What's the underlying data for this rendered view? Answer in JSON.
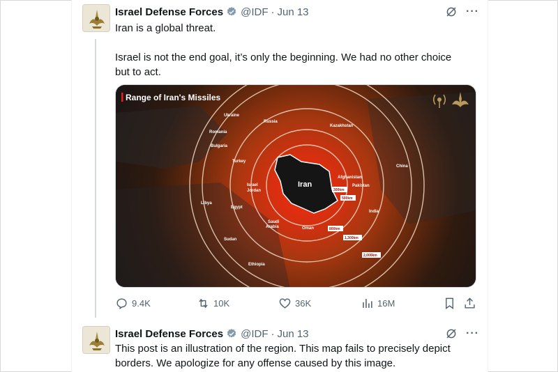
{
  "colors": {
    "text": "#0f1419",
    "muted": "#536471",
    "verified": "#829aab"
  },
  "posts": [
    {
      "name": "Israel Defense Forces",
      "handle": "@IDF",
      "separator": "·",
      "date": "Jun 13",
      "text_lines": [
        "Iran is a global threat.",
        "Israel is not the end goal, it’s only the beginning. We had no other choice",
        "but to act."
      ],
      "media": {
        "title": "Range of Iran's Missiles",
        "center_label": "Iran",
        "countries": [
          "Ukraine",
          "Russia",
          "Kazakhstan",
          "Romania",
          "Bulgaria",
          "Turkey",
          "China",
          "Afghanistan",
          "Pakistan",
          "Israel",
          "Jordan",
          "Libya",
          "Egypt",
          "India",
          "Saudi",
          "Arabia",
          "Oman",
          "Sudan",
          "Ethiopia"
        ],
        "ranges": [
          "300km",
          "500km",
          "800km",
          "1,300km",
          "2,000km"
        ]
      },
      "stats": {
        "replies": "9.4K",
        "reposts": "10K",
        "likes": "36K",
        "views": "16M"
      }
    },
    {
      "name": "Israel Defense Forces",
      "handle": "@IDF",
      "separator": "·",
      "date": "Jun 13",
      "text_lines": [
        "This post is an illustration of the region. This map fails to precisely depict",
        "borders. We apologize for any offense caused by this image."
      ]
    }
  ],
  "icons": [
    "grok-icon",
    "more-icon",
    "reply-icon",
    "repost-icon",
    "like-icon",
    "views-icon",
    "bookmark-icon",
    "share-icon",
    "verified-icon"
  ]
}
